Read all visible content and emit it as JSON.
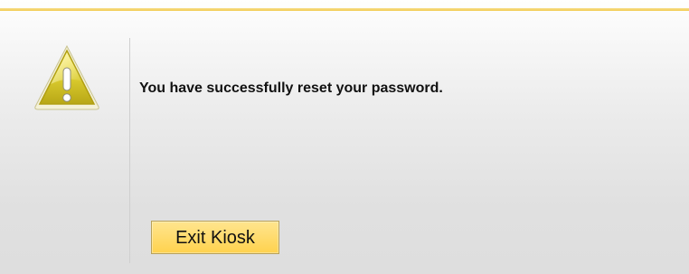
{
  "dialog": {
    "message": "You have successfully reset your password.",
    "icon": "warning-icon",
    "exit_button_label": "Exit Kiosk",
    "accent_color": "#f2c94a",
    "button_color": "#ffd24d"
  }
}
